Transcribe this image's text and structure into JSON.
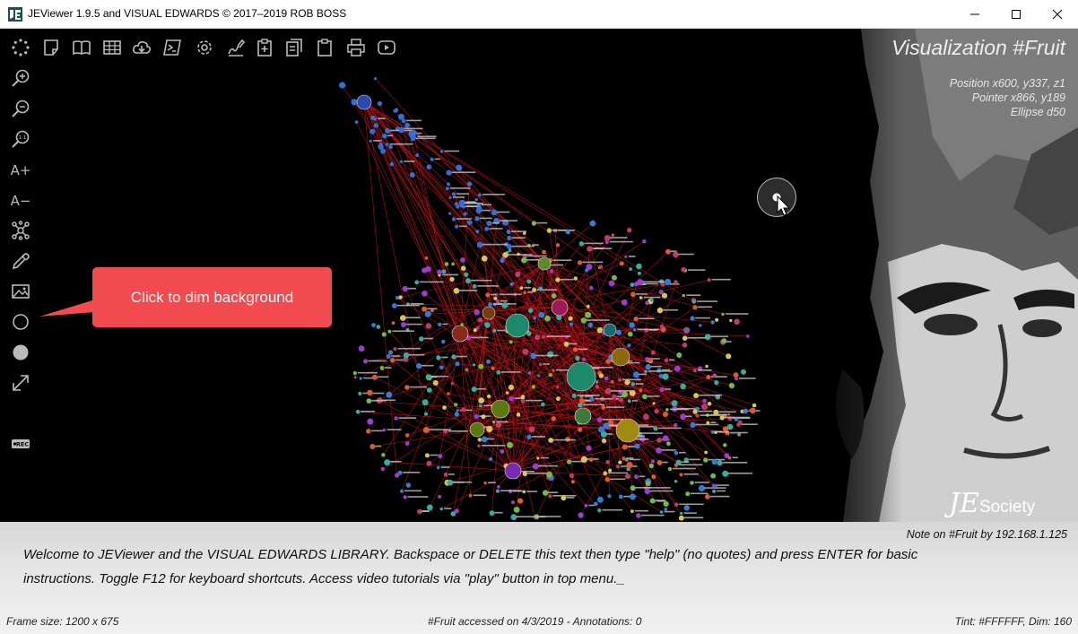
{
  "window": {
    "title": "JEViewer 1.9.5 and VISUAL EDWARDS © 2017–2019 ROB BOSS",
    "controls": [
      "minimize-icon",
      "maximize-icon",
      "close-icon"
    ]
  },
  "toolbar_top": {
    "icons": [
      "loading-spinner-icon",
      "note-icon",
      "book-icon",
      "grid-icon",
      "cloud-download-icon",
      "powershell-icon",
      "gear-icon",
      "signature-icon",
      "clipboard-add-icon",
      "clipboard-copy-icon",
      "clipboard-icon",
      "print-icon",
      "play-icon"
    ]
  },
  "toolbar_left": {
    "icons": [
      "zoom-in-icon",
      "zoom-out-icon",
      "zoom-reset-icon",
      "font-increase-icon",
      "font-decrease-icon",
      "network-icon",
      "eyedropper-icon",
      "image-icon",
      "circle-outline-icon",
      "circle-filled-icon",
      "expand-icon",
      "record-icon"
    ],
    "zoom_reset_label": "1:1",
    "font_increase_label": "A+",
    "font_decrease_label": "A−",
    "record_label": "REC"
  },
  "visualization": {
    "title": "Visualization #Fruit",
    "position": "Position x600, y337, z1",
    "pointer": "Pointer x866, y189",
    "ellipse": "Ellipse d50"
  },
  "callout": {
    "text": "Click to dim background",
    "color": "#f24b4f"
  },
  "brand": {
    "je": "JE",
    "society": "Society"
  },
  "notes": {
    "note_by": "Note on #Fruit by 192.168.1.125",
    "text": "Welcome to JEViewer and the VISUAL EDWARDS LIBRARY. Backspace or DELETE this text then type \"help\" (no quotes) and press ENTER for basic instructions. Toggle F12 for keyboard shortcuts. Access video tutorials via \"play\" button in top menu._"
  },
  "status": {
    "frame_size": "Frame size: 1200 x 675",
    "accessed": "#Fruit accessed on 4/3/2019 - Annotations: 0",
    "tint": "Tint: #FFFFFF, Dim: 160"
  },
  "colors": {
    "background": "#000000",
    "edge": "#c0141b",
    "callout": "#f24b4f",
    "node_palette": [
      "#2f7fd8",
      "#6fbf3f",
      "#d8c84a",
      "#e05a2a",
      "#a03ad0",
      "#2fb0a0",
      "#c23a6a"
    ]
  }
}
